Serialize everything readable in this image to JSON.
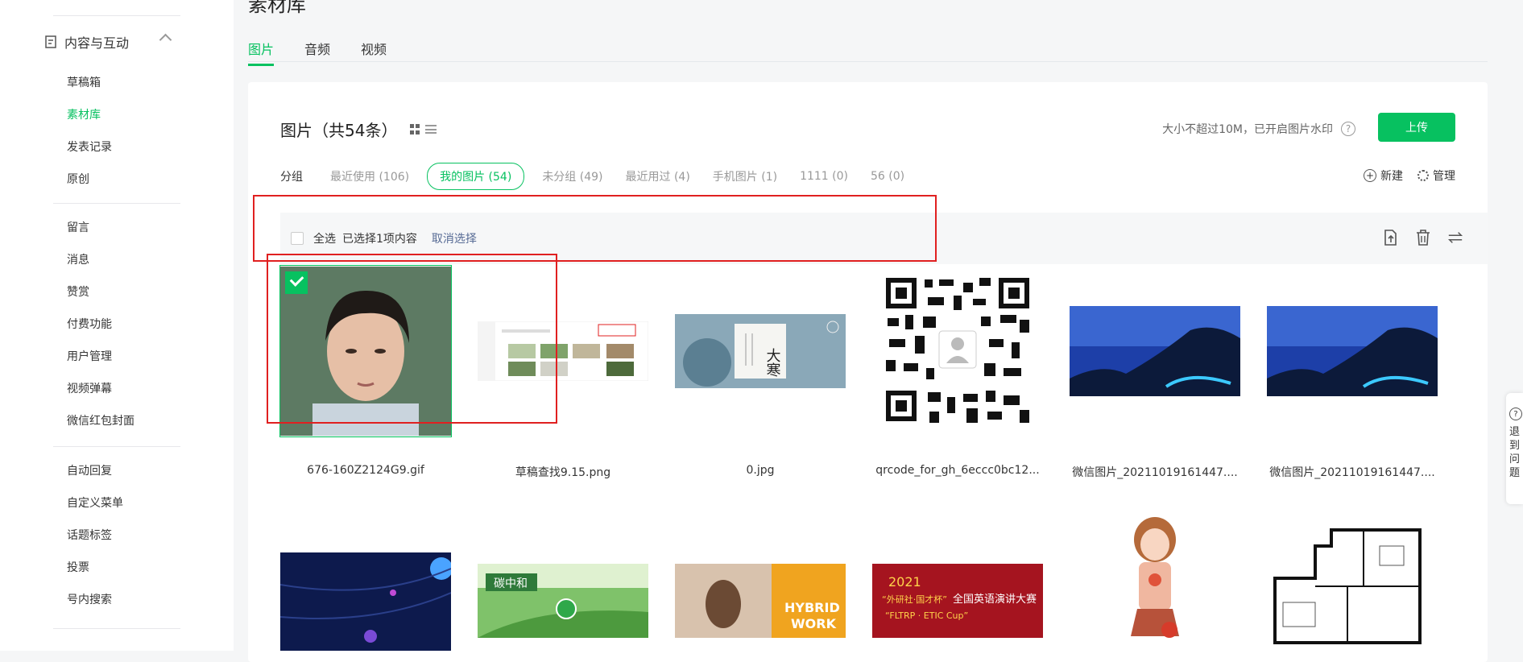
{
  "sidebar": {
    "group_label": "内容与互动",
    "items": [
      {
        "label": "草稿箱",
        "active": false
      },
      {
        "label": "素材库",
        "active": true
      },
      {
        "label": "发表记录",
        "active": false
      },
      {
        "label": "原创",
        "active": false
      },
      {
        "label": "留言",
        "active": false
      },
      {
        "label": "消息",
        "active": false
      },
      {
        "label": "赞赏",
        "active": false
      },
      {
        "label": "付费功能",
        "active": false
      },
      {
        "label": "用户管理",
        "active": false
      },
      {
        "label": "视频弹幕",
        "active": false
      },
      {
        "label": "微信红包封面",
        "active": false
      },
      {
        "label": "自动回复",
        "active": false
      },
      {
        "label": "自定义菜单",
        "active": false
      },
      {
        "label": "话题标签",
        "active": false
      },
      {
        "label": "投票",
        "active": false
      },
      {
        "label": "号内搜索",
        "active": false
      }
    ]
  },
  "header": {
    "title": "素材库",
    "tabs": [
      {
        "label": "图片",
        "active": true
      },
      {
        "label": "音频",
        "active": false
      },
      {
        "label": "视频",
        "active": false
      }
    ]
  },
  "card": {
    "title": "图片（共54条）",
    "limit_text": "大小不超过10M，已开启图片水印",
    "upload_label": "上传",
    "group_label": "分组",
    "groups": [
      {
        "label": "最近使用 (106)",
        "active": false
      },
      {
        "label": "我的图片 (54)",
        "active": true
      },
      {
        "label": "未分组 (49)",
        "active": false
      },
      {
        "label": "最近用过 (4)",
        "active": false
      },
      {
        "label": "手机图片 (1)",
        "active": false
      },
      {
        "label": "1111 (0)",
        "active": false
      },
      {
        "label": "56 (0)",
        "active": false
      }
    ],
    "new_label": "新建",
    "manage_label": "管理"
  },
  "selection_bar": {
    "select_all": "全选",
    "selected_text": "已选择1项内容",
    "cancel_label": "取消选择"
  },
  "images": [
    {
      "name": "676-160Z2124G9.gif",
      "selected": true
    },
    {
      "name": "草稿查找9.15.png",
      "selected": false
    },
    {
      "name": "0.jpg",
      "selected": false
    },
    {
      "name": "qrcode_for_gh_6eccc0bc12...",
      "selected": false
    },
    {
      "name": "微信图片_20211019161447....",
      "selected": false
    },
    {
      "name": "微信图片_20211019161447....",
      "selected": false
    }
  ],
  "image_texts": {
    "dahan_big": "大寒",
    "tanzhonghe": "碳中和",
    "hybrid_1": "HYBRID",
    "hybrid_2": "WORK",
    "contest_year": "2021",
    "contest_title": "全国英语演讲大赛",
    "contest_sub": "“外研社·国才杯”",
    "contest_cup": "“FLTRP · ETIC Cup”"
  },
  "side_tab": {
    "lines": [
      "退",
      "到",
      "问",
      "题"
    ]
  },
  "colors": {
    "accent": "#07c160",
    "annotation": "#e02020",
    "link": "#576b95"
  }
}
